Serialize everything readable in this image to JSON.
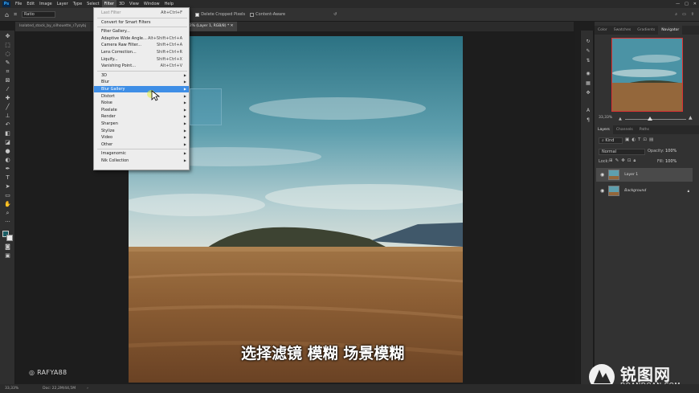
{
  "menubar": {
    "items": [
      "File",
      "Edit",
      "Image",
      "Layer",
      "Type",
      "Select",
      "Filter",
      "3D",
      "View",
      "Window",
      "Help"
    ],
    "active": "Filter"
  },
  "options": {
    "style_value": "Ratio",
    "delete_cropped": "Delete Cropped Pixels",
    "content_aware": "Content-Aware"
  },
  "tabs": [
    {
      "label": "Isolated_stock_by_silhouette_r7yzybj",
      "active": false
    },
    {
      "label": "jpg @ 33,3% (Layer 1, RGB/8) *",
      "active": true
    }
  ],
  "filter_menu": {
    "items": [
      {
        "label": "Last Filter",
        "shortcut": "Alt+Ctrl+F",
        "disabled": true
      },
      {
        "sep": true
      },
      {
        "label": "Convert for Smart Filters"
      },
      {
        "sep": true
      },
      {
        "label": "Filter Gallery..."
      },
      {
        "label": "Adaptive Wide Angle...",
        "shortcut": "Alt+Shift+Ctrl+A"
      },
      {
        "label": "Camera Raw Filter...",
        "shortcut": "Shift+Ctrl+A"
      },
      {
        "label": "Lens Correction...",
        "shortcut": "Shift+Ctrl+R"
      },
      {
        "label": "Liquify...",
        "shortcut": "Shift+Ctrl+X"
      },
      {
        "label": "Vanishing Point...",
        "shortcut": "Alt+Ctrl+V"
      },
      {
        "sep": true
      },
      {
        "label": "3D",
        "submenu": true
      },
      {
        "label": "Blur",
        "submenu": true
      },
      {
        "label": "Blur Gallery",
        "submenu": true,
        "highlighted": true
      },
      {
        "label": "Distort",
        "submenu": true
      },
      {
        "label": "Noise",
        "submenu": true
      },
      {
        "label": "Pixelate",
        "submenu": true
      },
      {
        "label": "Render",
        "submenu": true
      },
      {
        "label": "Sharpen",
        "submenu": true
      },
      {
        "label": "Stylize",
        "submenu": true
      },
      {
        "label": "Video",
        "submenu": true
      },
      {
        "label": "Other",
        "submenu": true
      },
      {
        "sep": true
      },
      {
        "label": "Imagenomic",
        "submenu": true
      },
      {
        "label": "Nik Collection",
        "submenu": true
      }
    ]
  },
  "panels": {
    "top_tabs": [
      "Color",
      "Swatches",
      "Gradients",
      "Navigator"
    ],
    "active_top_tab": "Navigator",
    "zoom": "33,33%",
    "layer_tabs": [
      "Layers",
      "Channels",
      "Paths"
    ],
    "active_layer_tab": "Layers",
    "kind": "Kind",
    "blend_mode": "Normal",
    "opacity_label": "Opacity:",
    "opacity": "100%",
    "lock_label": "Lock:",
    "fill_label": "Fill:",
    "fill": "100%",
    "layers": [
      {
        "name": "Layer 1",
        "selected": true
      },
      {
        "name": "Background",
        "selected": false
      }
    ]
  },
  "status": {
    "zoom": "33,33%",
    "doc": "Doc: 22,2M/44,5M"
  },
  "overlay": {
    "subtitle": "选择滤镜 模糊 场景模糊",
    "watermark": "RAFYA88",
    "site_cn": "锐图网",
    "site_en": "DOANDOAN.COM"
  },
  "colors": {
    "menu_highlight": "#3e8ee6",
    "nav_frame": "#dd3333",
    "ps_blue": "#31a8ff"
  }
}
